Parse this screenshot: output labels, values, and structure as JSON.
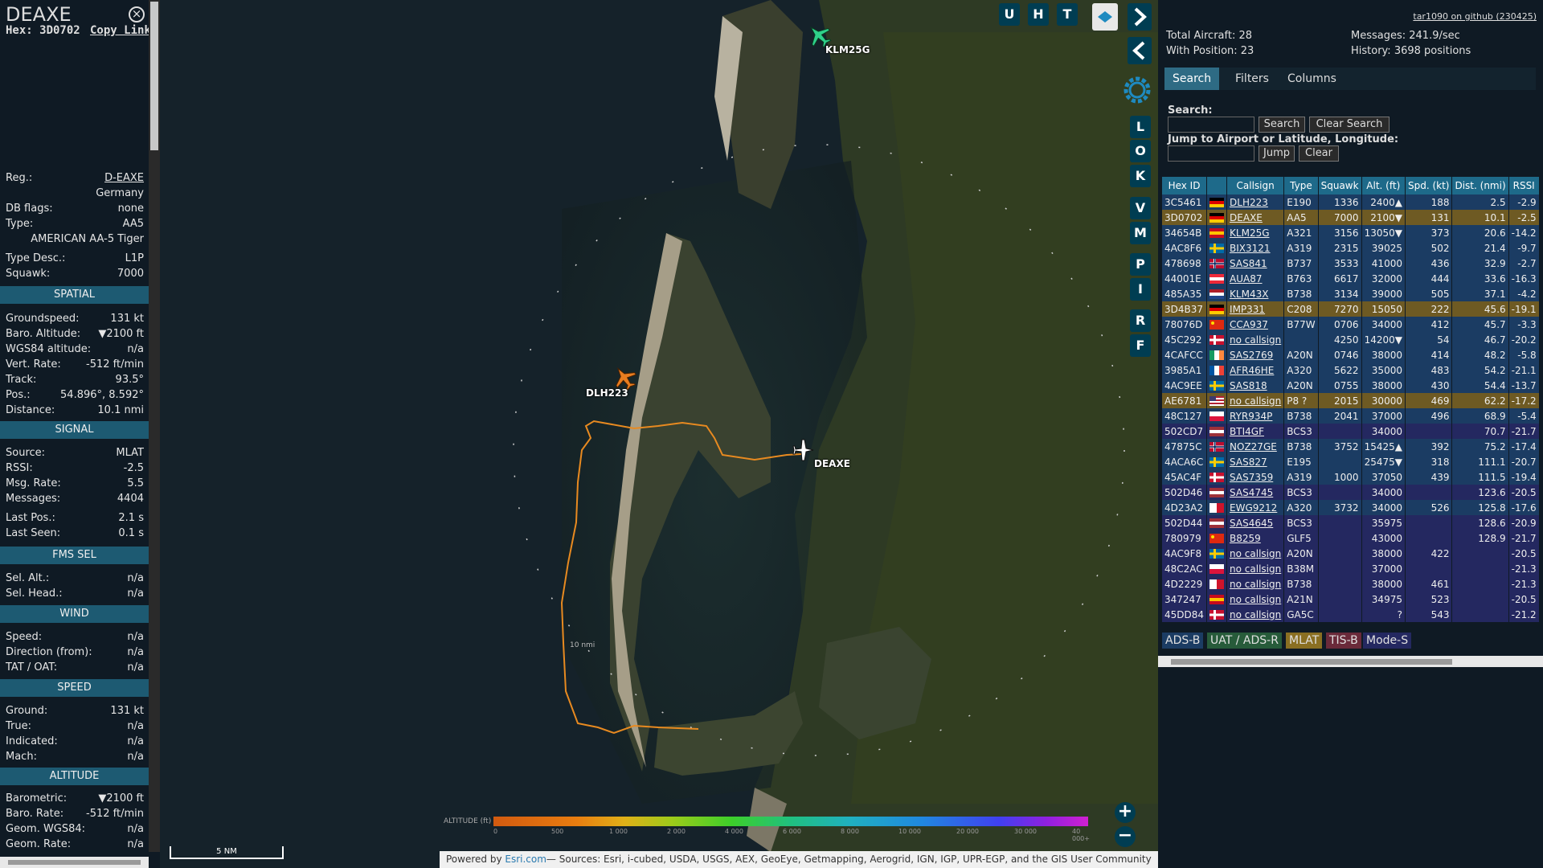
{
  "left_panel": {
    "callsign": "DEAXE",
    "hex": "Hex: 3D0702",
    "copy_link": "Copy Link",
    "reg_label": "Reg.:",
    "reg": "D-EAXE",
    "country": "Germany",
    "dbflags_label": "DB flags:",
    "dbflags": "none",
    "type_label": "Type:",
    "type": "AA5",
    "type_name": "AMERICAN AA-5 Tiger",
    "typedesc_label": "Type Desc.:",
    "typedesc": "L1P",
    "squawk_label": "Squawk:",
    "squawk": "7000",
    "spatial_title": "SPATIAL",
    "groundspeed_label": "Groundspeed:",
    "groundspeed": "131 kt",
    "baroalt_label": "Baro. Altitude:",
    "baroalt": "▼2100 ft",
    "wgs84_label": "WGS84 altitude:",
    "wgs84": "n/a",
    "vertrate_label": "Vert. Rate:",
    "vertrate": "-512 ft/min",
    "track_label": "Track:",
    "track": "93.5°",
    "pos_label": "Pos.:",
    "pos": "54.896°, 8.592°",
    "distance_label": "Distance:",
    "distance": "10.1 nmi",
    "signal_title": "SIGNAL",
    "source_label": "Source:",
    "source": "MLAT",
    "rssi_label": "RSSI:",
    "rssi": "-2.5",
    "msgrate_label": "Msg. Rate:",
    "msgrate": "5.5",
    "messages_label": "Messages:",
    "messages": "4404",
    "lastpos_label": "Last Pos.:",
    "lastpos": "2.1 s",
    "lastseen_label": "Last Seen:",
    "lastseen": "0.1 s",
    "fms_title": "FMS SEL",
    "selalt_label": "Sel. Alt.:",
    "selalt": "n/a",
    "selhead_label": "Sel. Head.:",
    "selhead": "n/a",
    "wind_title": "WIND",
    "speed_label": "Speed:",
    "speed": "n/a",
    "direction_label": "Direction (from):",
    "direction": "n/a",
    "tat_label": "TAT / OAT:",
    "tat": "n/a",
    "speed_title": "SPEED",
    "ground_label": "Ground:",
    "ground": "131 kt",
    "true_label": "True:",
    "true": "n/a",
    "indicated_label": "Indicated:",
    "indicated": "n/a",
    "mach_label": "Mach:",
    "mach": "n/a",
    "altitude_title": "ALTITUDE",
    "barometric_label": "Barometric:",
    "barometric": "▼2100 ft",
    "barorate_label": "Baro. Rate:",
    "barorate": "-512 ft/min",
    "geomwgs_label": "Geom. WGS84:",
    "geomwgs": "n/a",
    "geomrate_label": "Geom. Rate:",
    "geomrate": "n/a"
  },
  "map": {
    "buttons_top": [
      "U",
      "H",
      "T"
    ],
    "side_buttons": [
      "L",
      "O",
      "K",
      "V",
      "M",
      "P",
      "I",
      "R",
      "F"
    ],
    "aircraft": [
      {
        "label": "KLM25G",
        "color": "#2fd08a"
      },
      {
        "label": "DLH223",
        "color": "#e87d20"
      },
      {
        "label": "DEAXE",
        "color": "#ffffff"
      }
    ],
    "range_ring_label": "10 nmi",
    "scale_label": "5 NM",
    "altitude_legend_label": "ALTITUDE (ft)",
    "altitude_ticks": [
      "0",
      "500",
      "1 000",
      "2 000",
      "4 000",
      "6 000",
      "8 000",
      "10 000",
      "20 000",
      "30 000",
      "40 000+"
    ],
    "attribution_powered": "Powered by ",
    "attribution_esri": "Esri.com",
    "attribution_sources": "— Sources: Esri, i-cubed, USDA, USGS, AEX, GeoEye, Getmapping, Aerogrid, IGN, IGP, UPR-EGP, and the GIS User Community",
    "zoom_in": "+",
    "zoom_out": "−"
  },
  "right_panel": {
    "github_link": "tar1090 on github (230425)",
    "total_aircraft": "Total Aircraft: 28",
    "with_position": "With Position: 23",
    "messages_rate": "Messages: 241.9/sec",
    "history": "History: 3698 positions",
    "tabs": [
      "Search",
      "Filters",
      "Columns"
    ],
    "search_label": "Search:",
    "search_button": "Search",
    "clear_search_button": "Clear Search",
    "jump_label": "Jump to Airport or Latitude, Longitude:",
    "jump_button": "Jump",
    "clear_button": "Clear",
    "columns": [
      "Hex ID",
      "",
      "Callsign",
      "Type",
      "Squawk",
      "Alt. (ft)",
      "Spd. (kt)",
      "Dist. (nmi)",
      "RSSI"
    ],
    "rows": [
      {
        "hex": "3C5461",
        "flag": "de",
        "callsign": "DLH223",
        "type": "E190",
        "squawk": "1336",
        "alt": "2400▲",
        "spd": "188",
        "dist": "2.5",
        "rssi": "-2.9",
        "src": "adsb"
      },
      {
        "hex": "3D0702",
        "flag": "de",
        "callsign": "DEAXE",
        "type": "AA5",
        "squawk": "7000",
        "alt": "2100▼",
        "spd": "131",
        "dist": "10.1",
        "rssi": "-2.5",
        "src": "mlat"
      },
      {
        "hex": "34654B",
        "flag": "es",
        "callsign": "KLM25G",
        "type": "A321",
        "squawk": "3156",
        "alt": "13050▼",
        "spd": "373",
        "dist": "20.6",
        "rssi": "-14.2",
        "src": "adsb"
      },
      {
        "hex": "4AC8F6",
        "flag": "se",
        "callsign": "BIX3121",
        "type": "A319",
        "squawk": "2315",
        "alt": "39025",
        "spd": "502",
        "dist": "21.4",
        "rssi": "-9.7",
        "src": "adsb"
      },
      {
        "hex": "478698",
        "flag": "no",
        "callsign": "SAS841",
        "type": "B737",
        "squawk": "3533",
        "alt": "41000",
        "spd": "436",
        "dist": "32.9",
        "rssi": "-2.7",
        "src": "adsb"
      },
      {
        "hex": "44001E",
        "flag": "at",
        "callsign": "AUA87",
        "type": "B763",
        "squawk": "6617",
        "alt": "32000",
        "spd": "444",
        "dist": "33.6",
        "rssi": "-16.3",
        "src": "adsb"
      },
      {
        "hex": "485A35",
        "flag": "nl",
        "callsign": "KLM43X",
        "type": "B738",
        "squawk": "3134",
        "alt": "39000",
        "spd": "505",
        "dist": "37.1",
        "rssi": "-4.2",
        "src": "adsb"
      },
      {
        "hex": "3D4B37",
        "flag": "de",
        "callsign": "IMP331",
        "type": "C208",
        "squawk": "7270",
        "alt": "15050",
        "spd": "222",
        "dist": "45.6",
        "rssi": "-19.1",
        "src": "mlat"
      },
      {
        "hex": "78076D",
        "flag": "cn",
        "callsign": "CCA937",
        "type": "B77W",
        "squawk": "0706",
        "alt": "34000",
        "spd": "412",
        "dist": "45.7",
        "rssi": "-3.3",
        "src": "adsb"
      },
      {
        "hex": "45C292",
        "flag": "dk",
        "callsign": "no callsign",
        "type": "",
        "squawk": "4250",
        "alt": "14200▼",
        "spd": "54",
        "dist": "46.7",
        "rssi": "-20.2",
        "src": "adsb"
      },
      {
        "hex": "4CAFCC",
        "flag": "ie",
        "callsign": "SAS2769",
        "type": "A20N",
        "squawk": "0746",
        "alt": "38000",
        "spd": "414",
        "dist": "48.2",
        "rssi": "-5.8",
        "src": "adsb"
      },
      {
        "hex": "3985A1",
        "flag": "fr",
        "callsign": "AFR46HE",
        "type": "A320",
        "squawk": "5622",
        "alt": "35000",
        "spd": "483",
        "dist": "54.2",
        "rssi": "-21.1",
        "src": "adsb"
      },
      {
        "hex": "4AC9EE",
        "flag": "se",
        "callsign": "SAS818",
        "type": "A20N",
        "squawk": "0755",
        "alt": "38000",
        "spd": "430",
        "dist": "54.4",
        "rssi": "-13.7",
        "src": "adsb"
      },
      {
        "hex": "AE6781",
        "flag": "us",
        "callsign": "no callsign",
        "type": "P8 ?",
        "squawk": "2015",
        "alt": "30000",
        "spd": "469",
        "dist": "62.2",
        "rssi": "-17.2",
        "src": "mlat"
      },
      {
        "hex": "48C127",
        "flag": "pl",
        "callsign": "RYR934P",
        "type": "B738",
        "squawk": "2041",
        "alt": "37000",
        "spd": "496",
        "dist": "68.9",
        "rssi": "-5.4",
        "src": "adsb"
      },
      {
        "hex": "502CD7",
        "flag": "lv",
        "callsign": "BTI4GF",
        "type": "BCS3",
        "squawk": "",
        "alt": "34000",
        "spd": "",
        "dist": "70.7",
        "rssi": "-21.7",
        "src": "modes"
      },
      {
        "hex": "47875C",
        "flag": "no",
        "callsign": "NOZ27GE",
        "type": "B738",
        "squawk": "3752",
        "alt": "15425▲",
        "spd": "392",
        "dist": "75.2",
        "rssi": "-17.4",
        "src": "adsb"
      },
      {
        "hex": "4ACA6C",
        "flag": "se",
        "callsign": "SAS827",
        "type": "E195",
        "squawk": "",
        "alt": "25475▼",
        "spd": "318",
        "dist": "111.1",
        "rssi": "-20.7",
        "src": "adsb"
      },
      {
        "hex": "45AC4F",
        "flag": "dk",
        "callsign": "SAS7359",
        "type": "A319",
        "squawk": "1000",
        "alt": "37050",
        "spd": "439",
        "dist": "111.5",
        "rssi": "-19.4",
        "src": "adsb"
      },
      {
        "hex": "502D46",
        "flag": "lv",
        "callsign": "SAS4745",
        "type": "BCS3",
        "squawk": "",
        "alt": "34000",
        "spd": "",
        "dist": "123.6",
        "rssi": "-20.5",
        "src": "modes"
      },
      {
        "hex": "4D23A2",
        "flag": "mt",
        "callsign": "EWG9212",
        "type": "A320",
        "squawk": "3732",
        "alt": "34000",
        "spd": "526",
        "dist": "125.8",
        "rssi": "-17.6",
        "src": "adsb"
      },
      {
        "hex": "502D44",
        "flag": "lv",
        "callsign": "SAS4645",
        "type": "BCS3",
        "squawk": "",
        "alt": "35975",
        "spd": "",
        "dist": "128.6",
        "rssi": "-20.9",
        "src": "modes"
      },
      {
        "hex": "780979",
        "flag": "cn",
        "callsign": "B8259",
        "type": "GLF5",
        "squawk": "",
        "alt": "43000",
        "spd": "",
        "dist": "128.9",
        "rssi": "-21.7",
        "src": "modes"
      },
      {
        "hex": "4AC9F8",
        "flag": "se",
        "callsign": "no callsign",
        "type": "A20N",
        "squawk": "",
        "alt": "38000",
        "spd": "422",
        "dist": "",
        "rssi": "-20.5",
        "src": "modes"
      },
      {
        "hex": "48C2AC",
        "flag": "pl",
        "callsign": "no callsign",
        "type": "B38M",
        "squawk": "",
        "alt": "37000",
        "spd": "",
        "dist": "",
        "rssi": "-21.3",
        "src": "modes"
      },
      {
        "hex": "4D2229",
        "flag": "mt",
        "callsign": "no callsign",
        "type": "B738",
        "squawk": "",
        "alt": "38000",
        "spd": "461",
        "dist": "",
        "rssi": "-21.3",
        "src": "modes"
      },
      {
        "hex": "347247",
        "flag": "es",
        "callsign": "no callsign",
        "type": "A21N",
        "squawk": "",
        "alt": "34975",
        "spd": "523",
        "dist": "",
        "rssi": "-20.5",
        "src": "modes"
      },
      {
        "hex": "45DD84",
        "flag": "dk",
        "callsign": "no callsign",
        "type": "GA5C",
        "squawk": "",
        "alt": "?",
        "spd": "543",
        "dist": "",
        "rssi": "-21.2",
        "src": "modes"
      }
    ],
    "legend": [
      {
        "label": "ADS-B",
        "color": "#1b3c63"
      },
      {
        "label": "UAT / ADS-R",
        "color": "#275b3a"
      },
      {
        "label": "MLAT",
        "color": "#8a6f22"
      },
      {
        "label": "TIS-B",
        "color": "#6a2a3a"
      },
      {
        "label": "Mode-S",
        "color": "#242860"
      }
    ]
  }
}
